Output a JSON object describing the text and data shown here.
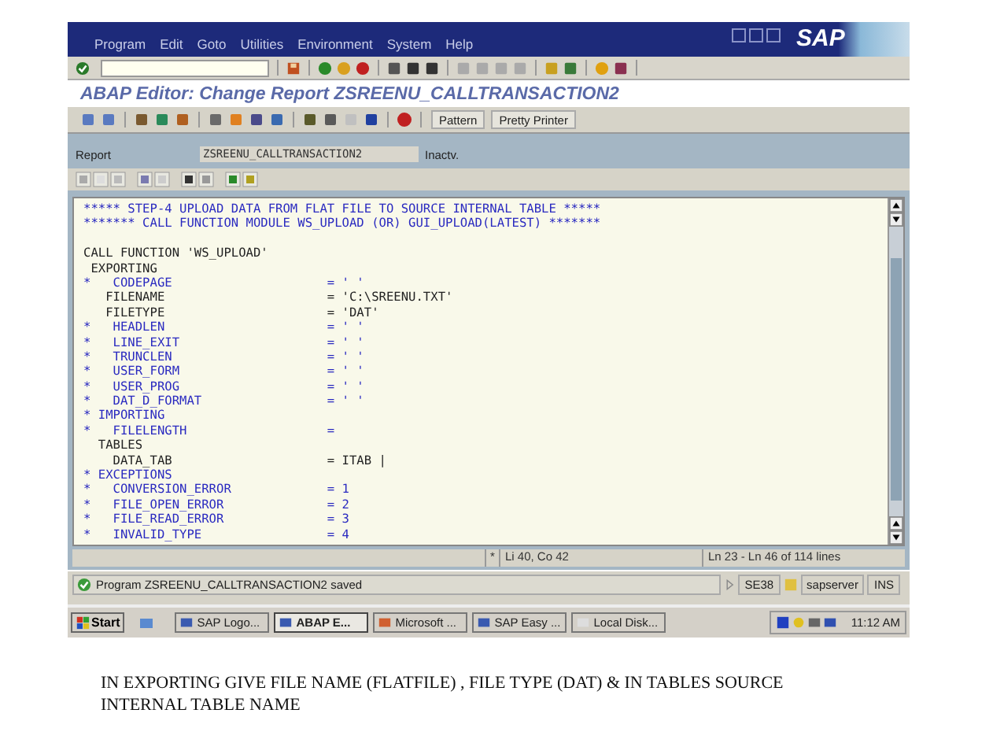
{
  "window": {
    "menu": [
      "Program",
      "Edit",
      "Goto",
      "Utilities",
      "Environment",
      "System",
      "Help"
    ],
    "logo": "SAP"
  },
  "title": "ABAP Editor: Change Report ZSREENU_CALLTRANSACTION2",
  "app_toolbar": {
    "buttons": [
      "Pattern",
      "Pretty Printer"
    ]
  },
  "report": {
    "label": "Report",
    "value": "ZSREENU_CALLTRANSACTION2",
    "status": "Inactv."
  },
  "editor": {
    "lines": [
      {
        "kind": "comment",
        "text": "***** STEP-4 UPLOAD DATA FROM FLAT FILE TO SOURCE INTERNAL TABLE *****"
      },
      {
        "kind": "comment",
        "text": "******* CALL FUNCTION MODULE WS_UPLOAD (OR) GUI_UPLOAD(LATEST) *******"
      },
      {
        "kind": "blank"
      },
      {
        "kind": "code",
        "text": "CALL FUNCTION 'WS_UPLOAD'"
      },
      {
        "kind": "code",
        "text": " EXPORTING"
      },
      {
        "kind": "comment",
        "text": "*   CODEPAGE                     = ' '"
      },
      {
        "kind": "code",
        "text": "   FILENAME                      = 'C:\\SREENU.TXT'"
      },
      {
        "kind": "code",
        "text": "   FILETYPE                      = 'DAT'"
      },
      {
        "kind": "comment",
        "text": "*   HEADLEN                      = ' '"
      },
      {
        "kind": "comment",
        "text": "*   LINE_EXIT                    = ' '"
      },
      {
        "kind": "comment",
        "text": "*   TRUNCLEN                     = ' '"
      },
      {
        "kind": "comment",
        "text": "*   USER_FORM                    = ' '"
      },
      {
        "kind": "comment",
        "text": "*   USER_PROG                    = ' '"
      },
      {
        "kind": "comment",
        "text": "*   DAT_D_FORMAT                 = ' '"
      },
      {
        "kind": "comment",
        "text": "* IMPORTING"
      },
      {
        "kind": "comment",
        "text": "*   FILELENGTH                   ="
      },
      {
        "kind": "code",
        "text": "  TABLES"
      },
      {
        "kind": "code",
        "text": "    DATA_TAB                     = ITAB |"
      },
      {
        "kind": "comment",
        "text": "* EXCEPTIONS"
      },
      {
        "kind": "comment",
        "text": "*   CONVERSION_ERROR             = 1"
      },
      {
        "kind": "comment",
        "text": "*   FILE_OPEN_ERROR              = 2"
      },
      {
        "kind": "comment",
        "text": "*   FILE_READ_ERROR              = 3"
      },
      {
        "kind": "comment",
        "text": "*   INVALID_TYPE                 = 4"
      }
    ]
  },
  "position": {
    "marker": "*",
    "cursor": "Li 40, Co 42",
    "range": "Ln 23 - Ln 46 of 114 lines"
  },
  "status_bar": {
    "message": "Program ZSREENU_CALLTRANSACTION2 saved",
    "transaction": "SE38",
    "server": "sapserver",
    "mode": "INS"
  },
  "taskbar": {
    "start": "Start",
    "items": [
      {
        "label": "SAP Logo...",
        "selected": false
      },
      {
        "label": "ABAP E...",
        "selected": true
      },
      {
        "label": "Microsoft ...",
        "selected": false
      },
      {
        "label": "SAP Easy ...",
        "selected": false
      },
      {
        "label": "Local Disk...",
        "selected": false
      }
    ],
    "clock": "11:12 AM"
  },
  "caption": "IN EXPORTING GIVE FILE NAME (FLATFILE) , FILE TYPE  (DAT)  & IN TABLES SOURCE INTERNAL TABLE NAME"
}
